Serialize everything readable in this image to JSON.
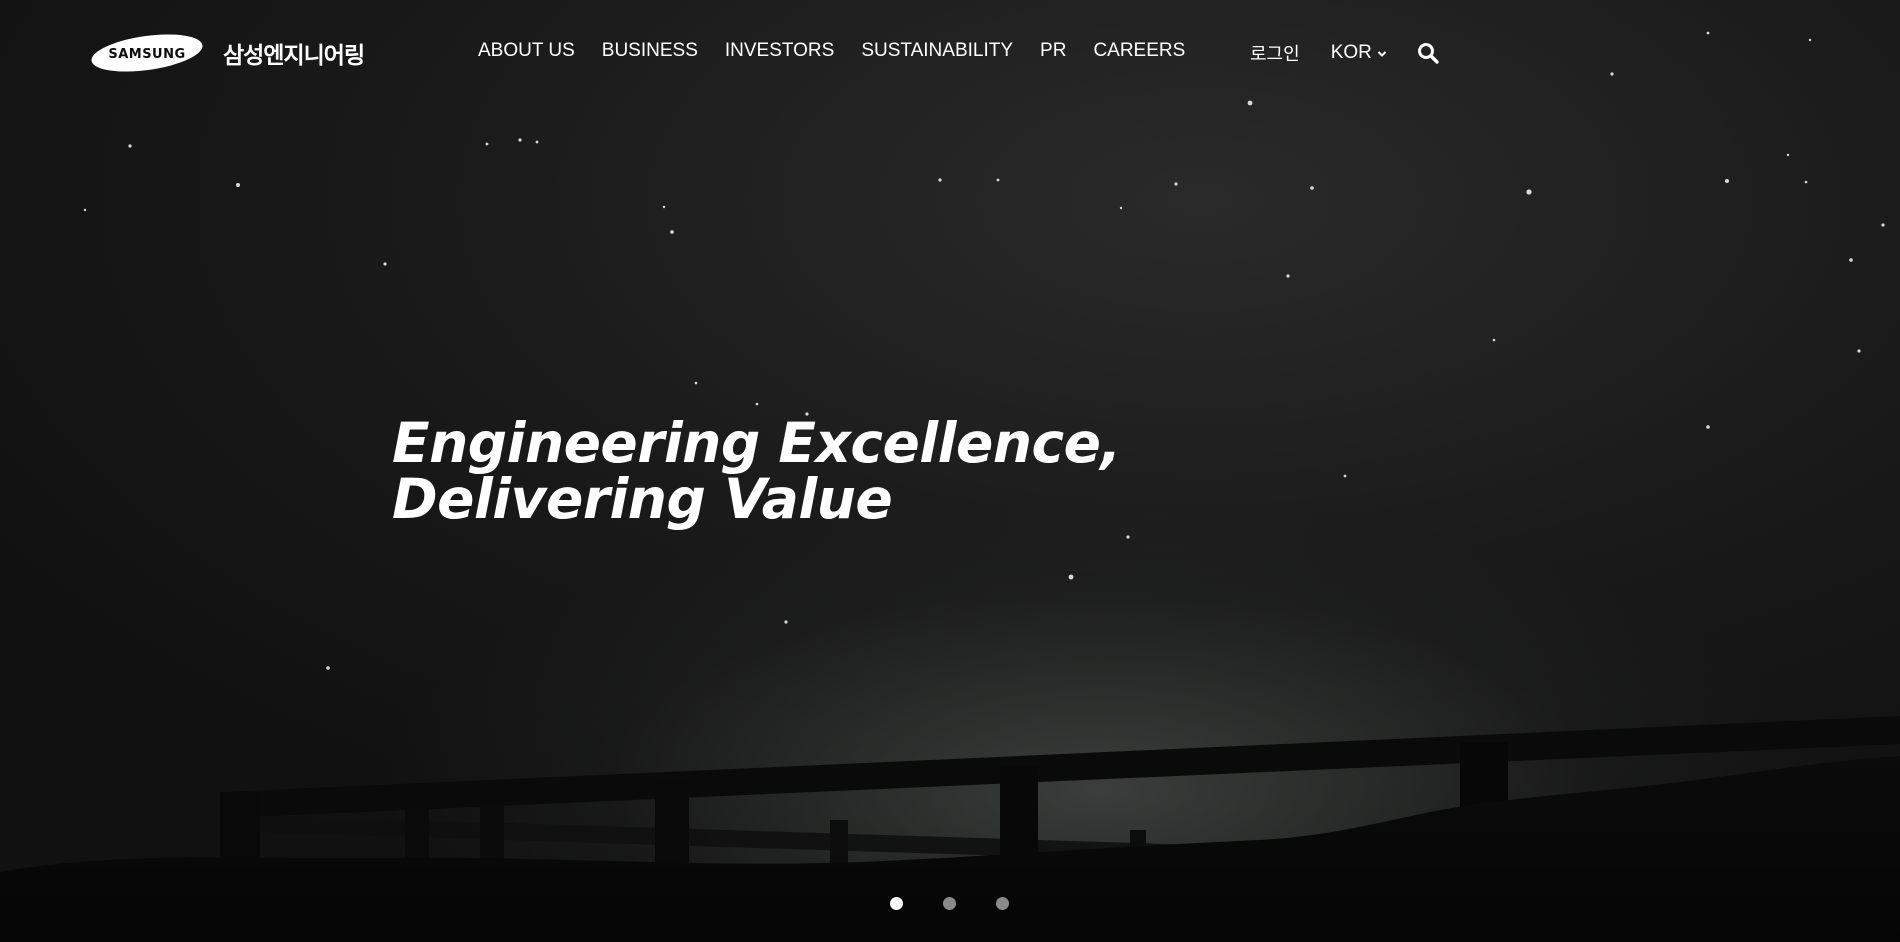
{
  "brand": {
    "wordmark": "SAMSUNG",
    "name_ko": "삼성엔지니어링"
  },
  "nav": {
    "items": [
      {
        "label": "ABOUT US"
      },
      {
        "label": "BUSINESS"
      },
      {
        "label": "INVESTORS"
      },
      {
        "label": "SUSTAINABILITY"
      },
      {
        "label": "PR"
      },
      {
        "label": "CAREERS"
      }
    ]
  },
  "utility": {
    "login_label": "로그인",
    "language_label": "KOR",
    "language_icon": "chevron-down-icon",
    "search_icon": "search-icon"
  },
  "hero": {
    "headline_line1": "Engineering Excellence,",
    "headline_line2": "Delivering Value"
  },
  "carousel": {
    "slide_count": 3,
    "active_index": 0
  },
  "colors": {
    "text": "#ffffff",
    "dot_active": "#ffffff",
    "dot_inactive": "#8a8a8a"
  }
}
